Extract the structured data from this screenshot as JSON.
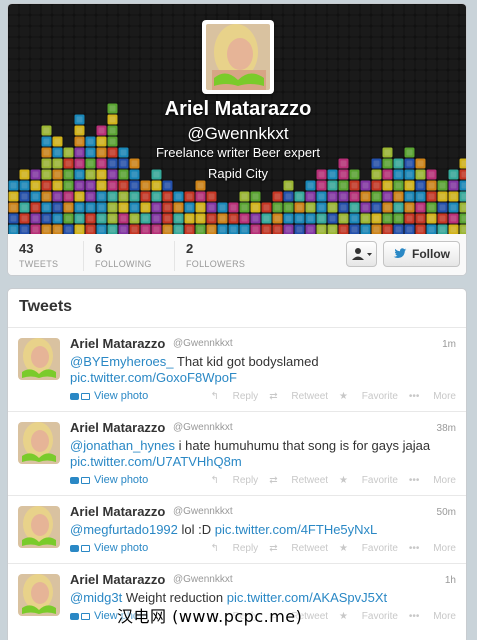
{
  "profile": {
    "name": "Ariel Matarazzo",
    "handle": "@Gwennkkxt",
    "bio": "Freelance writer Beer expert",
    "location": "Rapid City"
  },
  "stats": [
    {
      "count": "43",
      "label": "TWEETS"
    },
    {
      "count": "6",
      "label": "FOLLOWING"
    },
    {
      "count": "2",
      "label": "FOLLOWERS"
    }
  ],
  "buttons": {
    "user_menu_icon": "user-dropdown-icon",
    "follow_label": "Follow",
    "follow_icon": "twitter-bird-icon"
  },
  "tweets_header": "Tweets",
  "tweets": [
    {
      "name": "Ariel Matarazzo",
      "handle": "@Gwennkkxt",
      "time": "1m",
      "mention": "@BYEmyheroes_",
      "text": " That kid got bodyslamed",
      "link": "pic.twitter.com/GoxoF8WpoF",
      "view_photo": "View photo"
    },
    {
      "name": "Ariel Matarazzo",
      "handle": "@Gwennkkxt",
      "time": "38m",
      "mention": "@jonathan_hynes",
      "text": " i hate humuhumu that song is for gays jajaa",
      "link": "pic.twitter.com/U7ATVHhQ8m",
      "view_photo": "View photo"
    },
    {
      "name": "Ariel Matarazzo",
      "handle": "@Gwennkkxt",
      "time": "50m",
      "mention": "@megfurtado1992",
      "text": " lol :D ",
      "link": "pic.twitter.com/4FTHe5yNxL",
      "view_photo": "View photo"
    },
    {
      "name": "Ariel Matarazzo",
      "handle": "@Gwennkkxt",
      "time": "1h",
      "mention": "@midg3t",
      "text": " Weight reduction ",
      "link": "pic.twitter.com/AKASpvJ5Xt",
      "view_photo": "View photo"
    }
  ],
  "actions": {
    "reply": "Reply",
    "retweet": "Retweet",
    "favorite": "Favorite",
    "more": "More"
  },
  "watermark": "汉电网 (www.pcpc.me)"
}
